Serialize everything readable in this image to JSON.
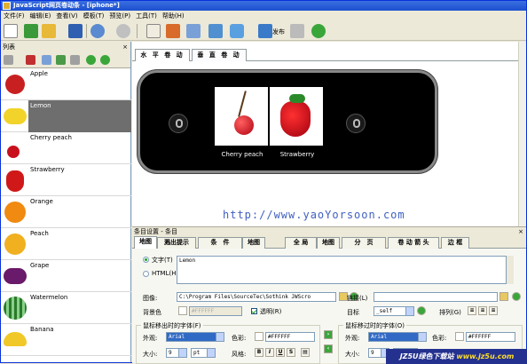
{
  "window": {
    "title": "JavaScript网页卷动条 - [iphone*]"
  },
  "menu": [
    "文件(F)",
    "编辑(E)",
    "查看(V)",
    "模板(T)",
    "预览(P)",
    "工具(T)",
    "帮助(H)"
  ],
  "toolbar": {
    "publish_label": "发布"
  },
  "list_panel": {
    "title": "列表",
    "items": [
      {
        "label": "Apple"
      },
      {
        "label": "Lemon"
      },
      {
        "label": "Cherry peach"
      },
      {
        "label": "Strawberry"
      },
      {
        "label": "Orange"
      },
      {
        "label": "Peach"
      },
      {
        "label": "Grape"
      },
      {
        "label": "Watermelon"
      },
      {
        "label": "Banana"
      }
    ],
    "selected_index": 1
  },
  "preview": {
    "tabs": [
      "水 平 卷 动",
      "垂 直 卷 动"
    ],
    "captions": [
      "Cherry peach",
      "Strawberry"
    ],
    "url": "http://www.yaoYorsoon.com"
  },
  "settings": {
    "title": "条目设置 - 条目",
    "tabs": [
      "地图",
      "溅出提示",
      "条　件",
      "地图",
      "全 局",
      "地图",
      "分　页",
      "卷 动 箭 头",
      "边 框"
    ],
    "text_label": "文字(T)",
    "html_label": "HTML(H)",
    "text_value": "Lemon",
    "image_label": "图像:",
    "image_value": "C:\\Program Files\\SourceTec\\Sothink JWScro",
    "link_label": "链接(L)",
    "link_value": "",
    "bgcolor_label": "背景色",
    "bgcolor_value": "#FFFFFF",
    "transparent_label": "透明(R)",
    "target_label": "目标",
    "target_value": "_self",
    "align_label": "排列(G)",
    "font_out_group": "鼠标移出时的字体(F)",
    "font_over_group": "鼠标移过时的字体(O)",
    "face_label": "外观:",
    "face_value": "Arial",
    "color_label": "色彩:",
    "color_value": "#FFFFFF",
    "size_label": "大小:",
    "size_value": "9",
    "unit_value": "pt",
    "style_label": "风格:",
    "style_buttons": [
      "B",
      "I",
      "U",
      "S"
    ]
  },
  "watermark": {
    "a": "JZ5U绿色下载站",
    "b": "www.jz5u.com"
  }
}
